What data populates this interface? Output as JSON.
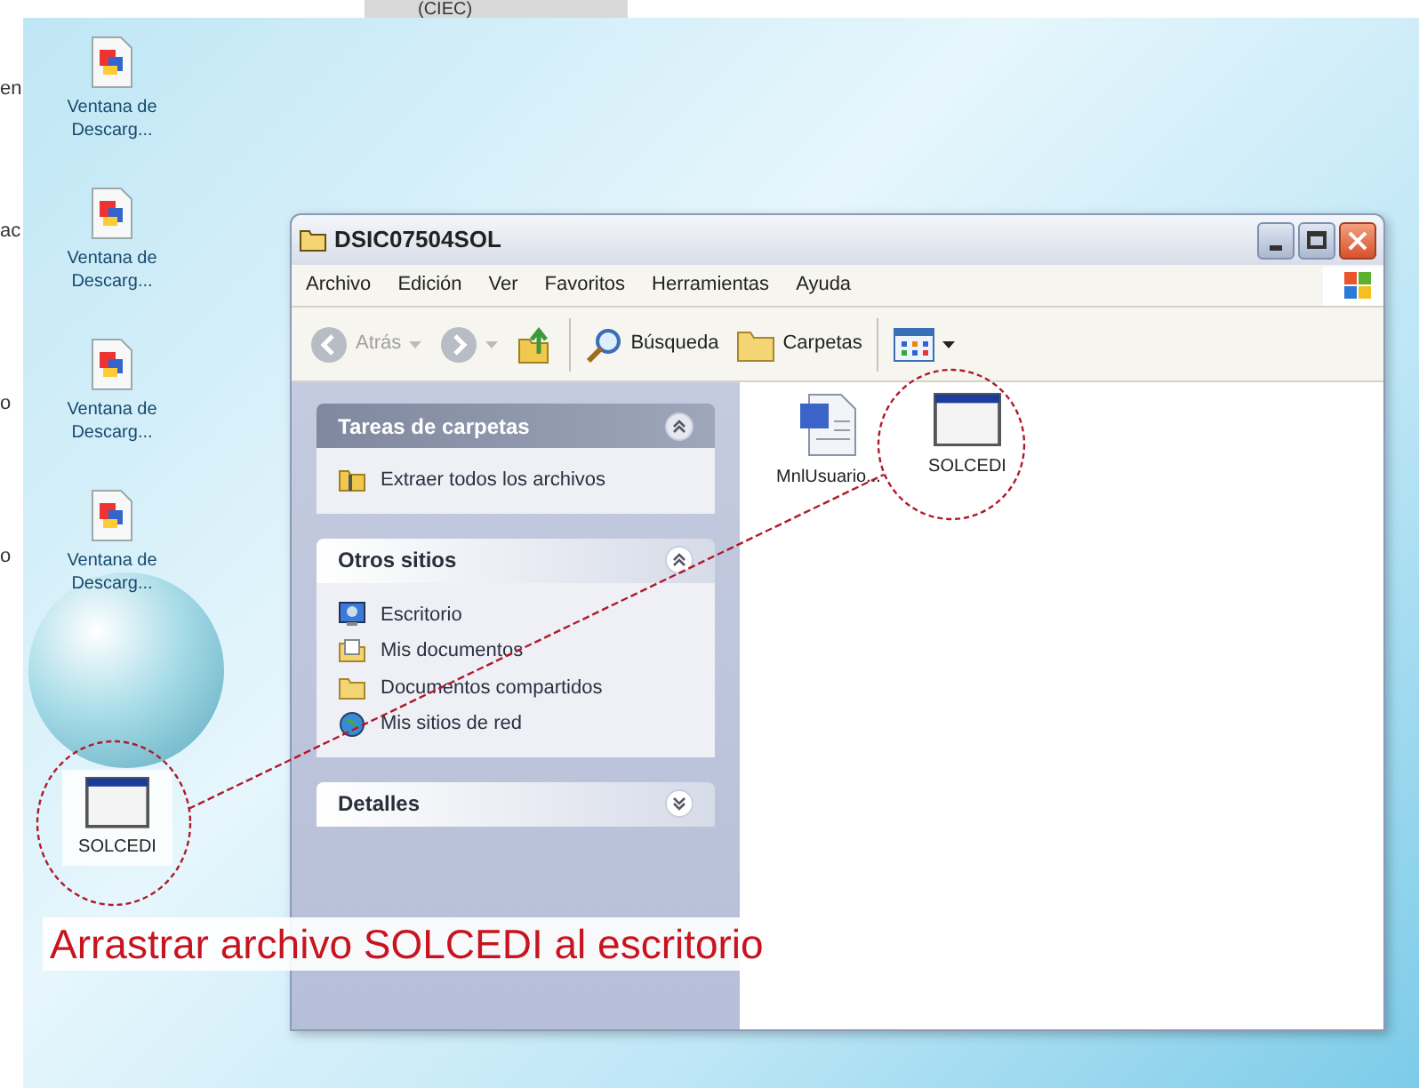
{
  "background_document": {
    "heading_fragment": "(CIEC)",
    "edge_fragments": [
      "en",
      "ac",
      "o",
      "o"
    ]
  },
  "desktop_icons": [
    {
      "label": "Ventana de Descarg...",
      "kind": "document"
    },
    {
      "label": "Ventana de Descarg...",
      "kind": "document"
    },
    {
      "label": "Ventana de Descarg...",
      "kind": "document"
    },
    {
      "label": "Ventana de Descarg...",
      "kind": "document"
    },
    {
      "label": "SOLCEDI",
      "kind": "program"
    }
  ],
  "window": {
    "title": "DSIC07504SOL",
    "menu": [
      "Archivo",
      "Edición",
      "Ver",
      "Favoritos",
      "Herramientas",
      "Ayuda"
    ],
    "toolbar": [
      {
        "label": "Atrás",
        "kind": "back",
        "disabled": true
      },
      {
        "kind": "forward",
        "disabled": true
      },
      {
        "kind": "up",
        "disabled": false
      },
      {
        "label": "Búsqueda",
        "kind": "search",
        "disabled": false
      },
      {
        "label": "Carpetas",
        "kind": "folders",
        "disabled": false
      },
      {
        "kind": "views",
        "disabled": false
      }
    ],
    "task_panes": [
      {
        "title": "Tareas de carpetas",
        "kind": "special",
        "expanded": true,
        "links": [
          {
            "label": "Extraer todos los archivos",
            "kind": "extract"
          }
        ]
      },
      {
        "title": "Otros sitios",
        "kind": "normal",
        "expanded": true,
        "links": [
          {
            "label": "Escritorio",
            "kind": "desktop"
          },
          {
            "label": "Mis documentos",
            "kind": "documents"
          },
          {
            "label": "Documentos compartidos",
            "kind": "folder"
          },
          {
            "label": "Mis sitios de red",
            "kind": "network"
          }
        ]
      },
      {
        "title": "Detalles",
        "kind": "normal",
        "expanded": false
      }
    ],
    "files": [
      {
        "label": "MnlUsuario...",
        "kind": "word"
      },
      {
        "label": "SOLCEDI",
        "kind": "program"
      }
    ]
  },
  "annotation": {
    "caption": "Arrastrar archivo SOLCEDI al escritorio"
  }
}
